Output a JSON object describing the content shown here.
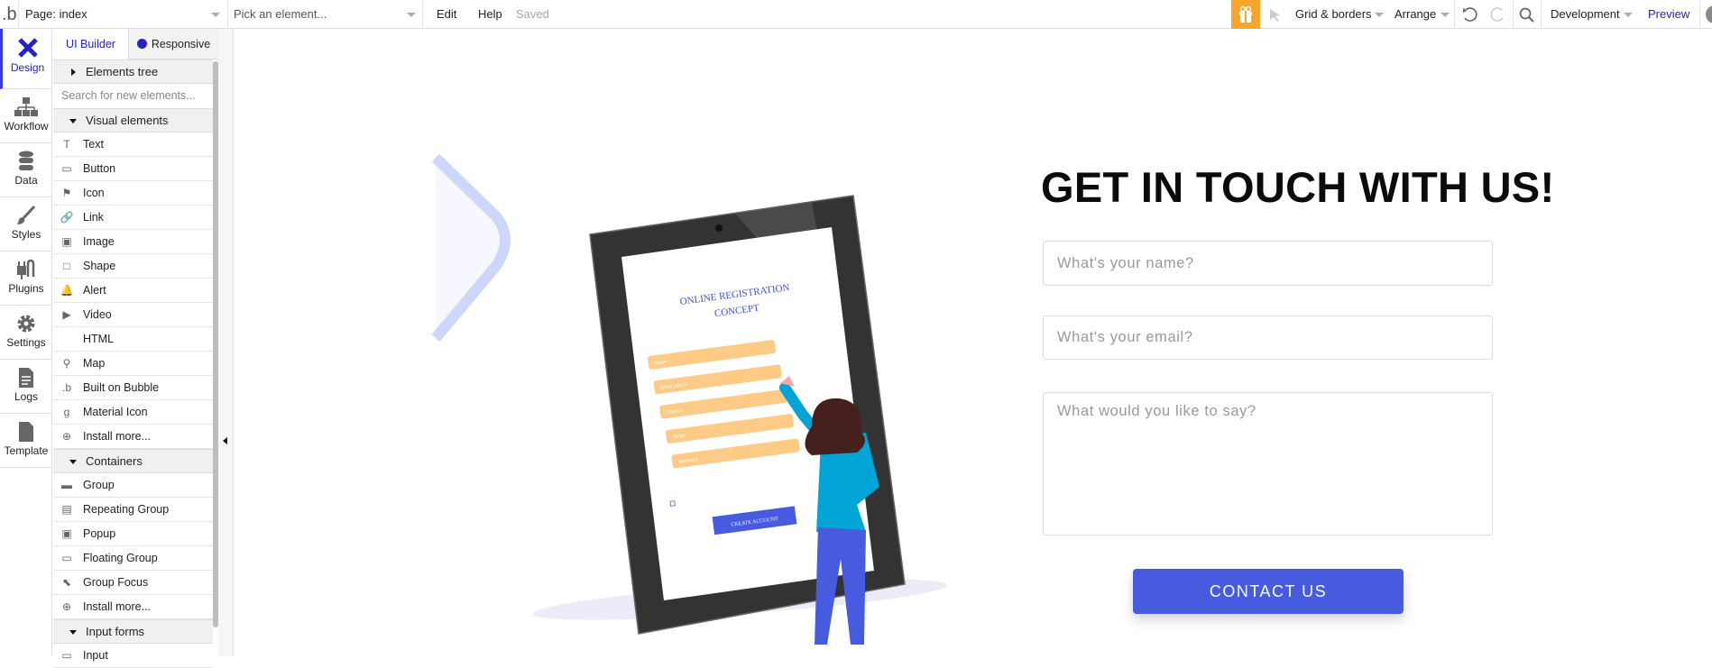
{
  "topbar": {
    "logo": ".b",
    "page_label": "Page: index",
    "element_picker_placeholder": "Pick an element...",
    "edit": "Edit",
    "help": "Help",
    "status": "Saved",
    "grid": "Grid & borders",
    "arrange": "Arrange",
    "environment": "Development",
    "preview": "Preview",
    "gift_color": "#F7A52B"
  },
  "nav": {
    "items": [
      {
        "label": "Design",
        "icon": "design-icon",
        "active": true
      },
      {
        "label": "Workflow",
        "icon": "workflow-icon"
      },
      {
        "label": "Data",
        "icon": "database-icon"
      },
      {
        "label": "Styles",
        "icon": "brush-icon"
      },
      {
        "label": "Plugins",
        "icon": "plug-icon"
      },
      {
        "label": "Settings",
        "icon": "gear-icon"
      },
      {
        "label": "Logs",
        "icon": "document-icon"
      },
      {
        "label": "Template",
        "icon": "file-icon"
      }
    ]
  },
  "panel": {
    "tab_ui_builder": "UI Builder",
    "tab_responsive": "Responsive",
    "elements_tree": "Elements tree",
    "search_placeholder": "Search for new elements...",
    "visual_header": "Visual elements",
    "visual": [
      "Text",
      "Button",
      "Icon",
      "Link",
      "Image",
      "Shape",
      "Alert",
      "Video",
      "HTML",
      "Map",
      "Built on Bubble",
      "Material Icon",
      "Install more..."
    ],
    "containers_header": "Containers",
    "containers": [
      "Group",
      "Repeating Group",
      "Popup",
      "Floating Group",
      "Group Focus",
      "Install more..."
    ],
    "input_header": "Input forms",
    "input": [
      "Input"
    ]
  },
  "canvas": {
    "heading": "GET IN TOUCH WITH US!",
    "name_placeholder": "What's your name?",
    "email_placeholder": "What's your email?",
    "message_placeholder": "What would you like to say?",
    "button": "CONTACT US",
    "accent": "#465BDD",
    "illustration": {
      "title1": "ONLINE REGISTRATION",
      "title2": "CONCEPT",
      "fields": [
        "Name",
        "Email adress",
        "Country",
        "Phone",
        "Password"
      ],
      "cta": "CREATE ACCOUNT"
    }
  }
}
